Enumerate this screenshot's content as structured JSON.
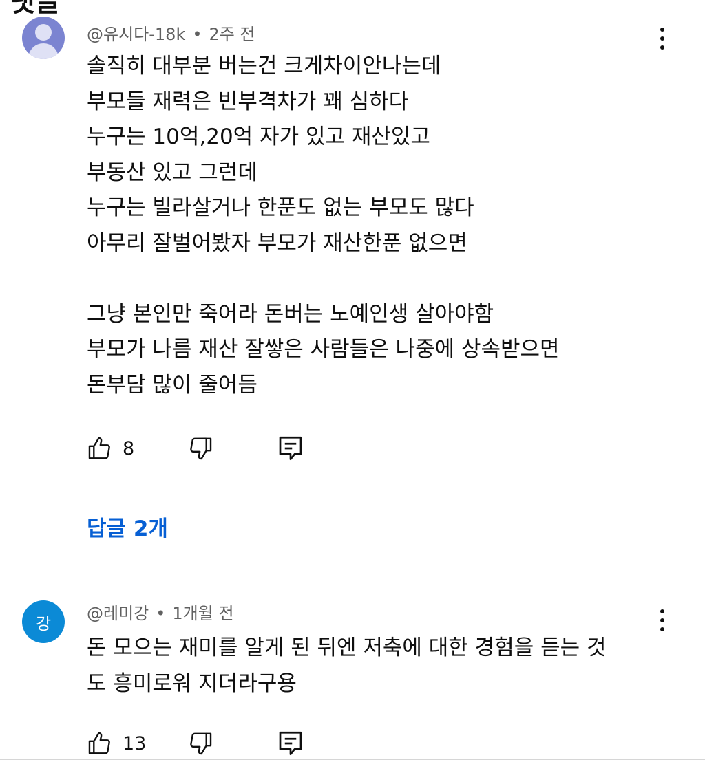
{
  "header": {
    "title": "댓글"
  },
  "comments": [
    {
      "author": "@유시다-18k",
      "age": "2주 전",
      "lines": [
        "솔직히 대부분 버는건 크게차이안나는데",
        "부모들 재력은 빈부격차가 꽤 심하다",
        "누구는 10억,20억 자가 있고 재산있고",
        "부동산 있고 그런데",
        "누구는 빌라살거나 한푼도 없는 부모도 많다",
        "아무리 잘벌어봤자 부모가 재산한푼 없으면",
        "",
        "그냥 본인만 죽어라 돈버는 노예인생 살아야함",
        "부모가 나름 재산 잘쌓은 사람들은 나중에 상속받으면",
        "돈부담 많이 줄어듬"
      ],
      "likes": "8",
      "replies_label": "답글 2개"
    },
    {
      "author": "@레미강",
      "age": "1개월 전",
      "avatar_letter": "강",
      "avatar_color": "#0b8ad6",
      "lines": [
        "돈 모으는 재미를 알게 된 뒤엔 저축에 대한 경험을 듣는 것",
        "도 흥미로워 지더라구용"
      ],
      "likes": "13"
    }
  ],
  "meta_separator": "•",
  "icons": [
    "like-icon",
    "dislike-icon",
    "reply-icon",
    "more-vert-icon"
  ],
  "colors": {
    "link": "#065fd4",
    "meta": "#606060",
    "text": "#0f0f0f"
  }
}
